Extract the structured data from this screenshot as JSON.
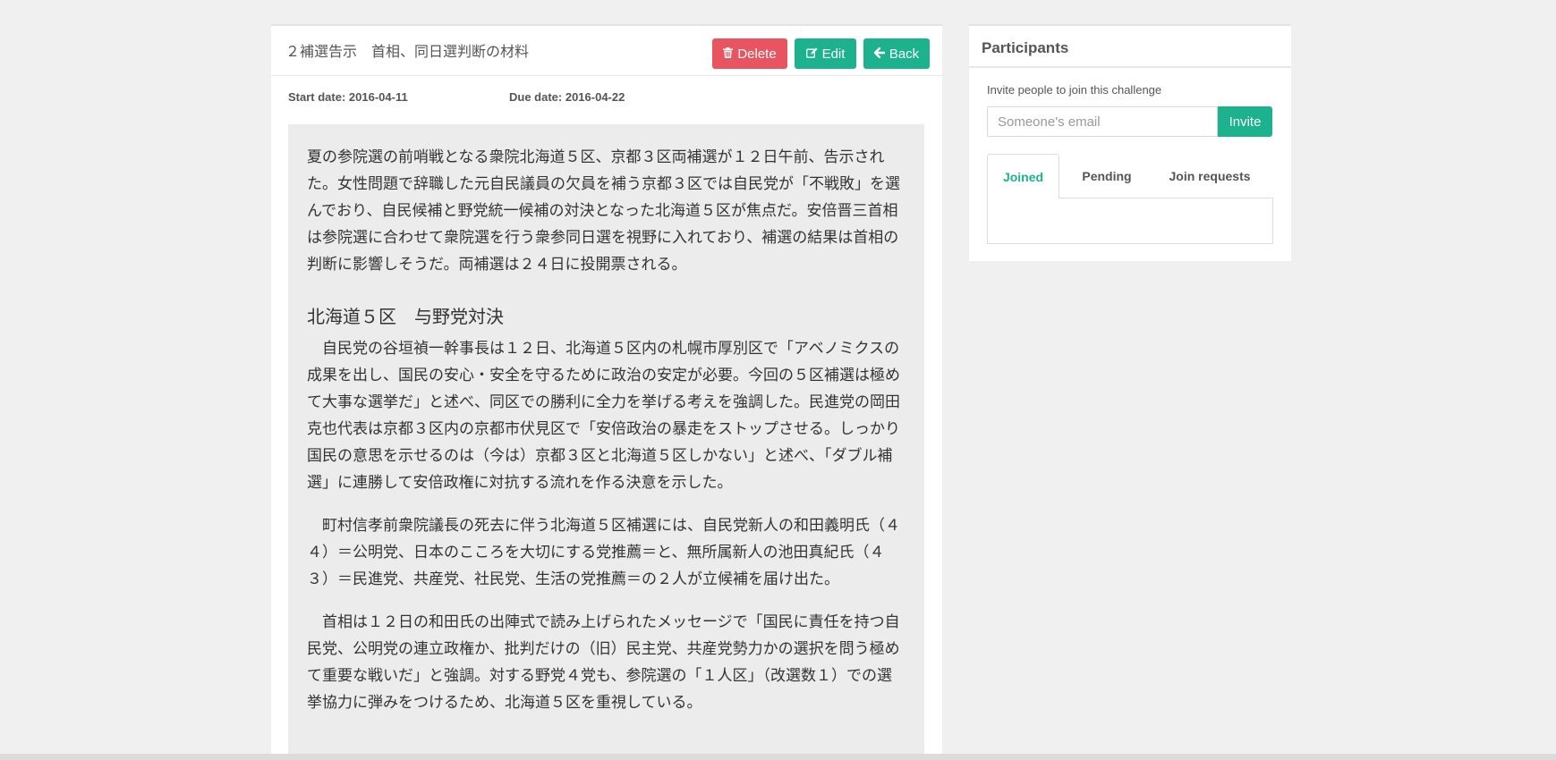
{
  "challenge": {
    "title": "２補選告示　首相、同日選判断の材料",
    "buttons": {
      "delete_icon": "trash-icon",
      "delete_label": "Delete",
      "edit_icon": "edit-icon",
      "edit_label": "Edit",
      "back_icon": "arrow-left-icon",
      "back_label": "Back"
    },
    "start_date": "Start date: 2016-04-11",
    "due_date": "Due date: 2016-04-22",
    "content": {
      "intro": "夏の参院選の前哨戦となる衆院北海道５区、京都３区両補選が１２日午前、告示された。女性問題で辞職した元自民議員の欠員を補う京都３区では自民党が「不戦敗」を選んでおり、自民候補と野党統一候補の対決となった北海道５区が焦点だ。安倍晋三首相は参院選に合わせて衆院選を行う衆参同日選を視野に入れており、補選の結果は首相の判断に影響しそうだ。両補選は２４日に投開票される。",
      "heading": "北海道５区　与野党対決",
      "paragraphs": [
        "自民党の谷垣禎一幹事長は１２日、北海道５区内の札幌市厚別区で「アベノミクスの成果を出し、国民の安心・安全を守るために政治の安定が必要。今回の５区補選は極めて大事な選挙だ」と述べ、同区での勝利に全力を挙げる考えを強調した。民進党の岡田克也代表は京都３区内の京都市伏見区で「安倍政治の暴走をストップさせる。しっかり国民の意思を示せるのは（今は）京都３区と北海道５区しかない」と述べ、「ダブル補選」に連勝して安倍政権に対抗する流れを作る決意を示した。",
        "町村信孝前衆院議長の死去に伴う北海道５区補選には、自民党新人の和田義明氏（４４）＝公明党、日本のこころを大切にする党推薦＝と、無所属新人の池田真紀氏（４３）＝民進党、共産党、社民党、生活の党推薦＝の２人が立候補を届け出た。",
        "首相は１２日の和田氏の出陣式で読み上げられたメッセージで「国民に責任を持つ自民党、公明党の連立政権か、批判だけの（旧）民主党、共産党勢力かの選択を問う極めて重要な戦いだ」と強調。対する野党４党も、参院選の「１人区」（改選数１）での選挙協力に弾みをつけるため、北海道５区を重視している。"
      ]
    }
  },
  "participants": {
    "title": "Participants",
    "invite_text": "Invite people to join this challenge",
    "email_placeholder": "Someone's email",
    "invite_label": "Invite",
    "tabs": [
      {
        "label": "Joined"
      },
      {
        "label": "Pending"
      },
      {
        "label": "Join requests"
      }
    ],
    "active_tab": "Joined"
  },
  "colors": {
    "accent": "#1cb28e",
    "danger": "#e8545f",
    "background": "#f0f0f1",
    "content_background": "#ececec"
  }
}
